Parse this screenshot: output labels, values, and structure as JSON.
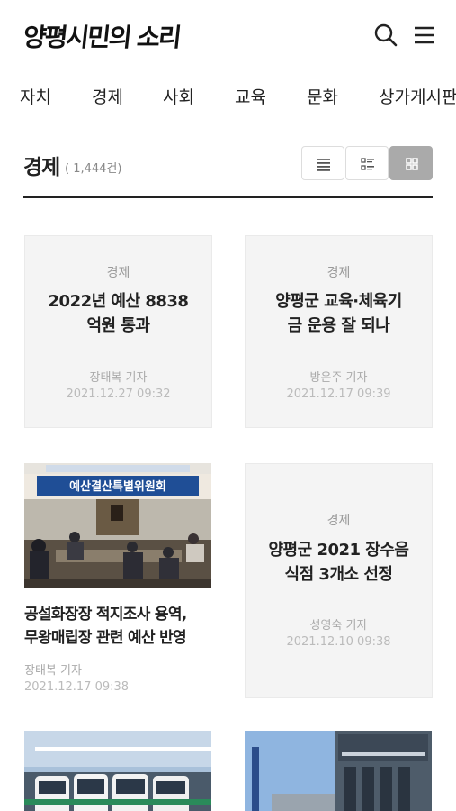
{
  "header": {
    "logo_text": "양평시민의 소리",
    "search_icon": "search-icon",
    "menu_icon": "hamburger-menu-icon"
  },
  "nav": {
    "items": [
      "자치",
      "경제",
      "사회",
      "교육",
      "문화",
      "상가게시판"
    ]
  },
  "section": {
    "title": "경제",
    "count": "( 1,444건)",
    "view_options": [
      "list-view-icon",
      "summary-view-icon",
      "grid-view-icon"
    ],
    "active_view": "grid-view-icon"
  },
  "articles": [
    {
      "category": "경제",
      "title_line1": "2022년 예산 8838",
      "title_line2": "억원 통과",
      "author": "장태복 기자",
      "date": "2021.12.27 09:32"
    },
    {
      "category": "경제",
      "title_line1": "양평군 교육·체육기",
      "title_line2": "금 운용 잘 되나",
      "author": "방은주 기자",
      "date": "2021.12.17 09:39"
    },
    {
      "title_line1": "공설화장장 적지조사 용역,",
      "title_line2": "무왕매립장 관련 예산 반영",
      "author": "장태복 기자",
      "date": "2021.12.17 09:38",
      "photo_banner": "예산결산특별위원회"
    },
    {
      "category": "경제",
      "title_line1": "양평군 2021 장수음",
      "title_line2": "식점 3개소 선정",
      "author": "성영숙 기자",
      "date": "2021.12.10 09:38"
    }
  ]
}
